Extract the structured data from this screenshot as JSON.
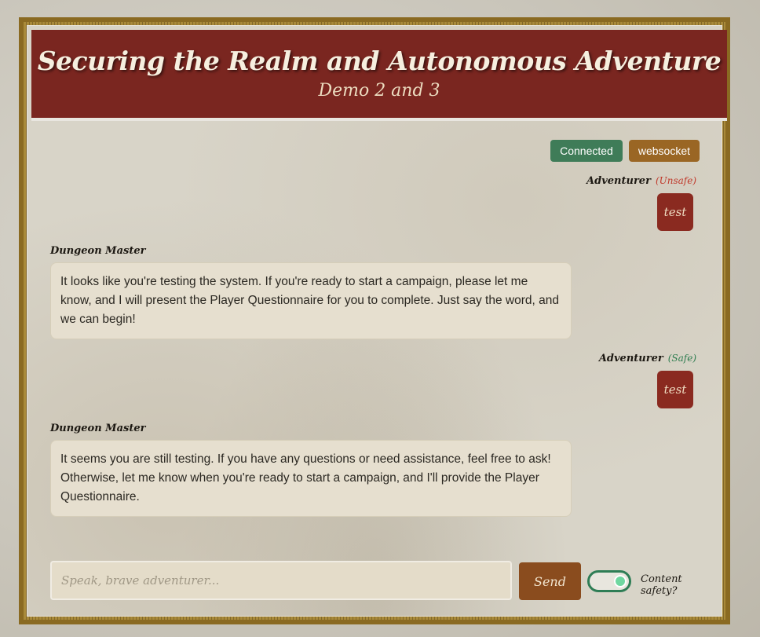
{
  "header": {
    "title": "Securing the Realm and Autonomous Adventure",
    "subtitle": "Demo 2 and 3"
  },
  "status": {
    "connection": "Connected",
    "transport": "websocket"
  },
  "messages": [
    {
      "role": "Adventurer",
      "safety": "(Unsafe)",
      "text": "test"
    },
    {
      "role": "Dungeon Master",
      "text": "It looks like you're testing the system. If you're ready to start a campaign, please let me know, and I will present the Player Questionnaire for you to complete. Just say the word, and we can begin!"
    },
    {
      "role": "Adventurer",
      "safety": "(Safe)",
      "text": "test"
    },
    {
      "role": "Dungeon Master",
      "text": "It seems you are still testing. If you have any questions or need assistance, feel free to ask! Otherwise, let me know when you're ready to start a campaign, and I'll provide the Player Questionnaire."
    }
  ],
  "composer": {
    "placeholder": "Speak, brave adventurer...",
    "send_label": "Send",
    "toggle_label": "Content safety?",
    "toggle_on": true
  },
  "colors": {
    "header_bg": "#7a2620",
    "connected": "#3f7c58",
    "websocket": "#9a6624",
    "send": "#8a4c1e",
    "toggle": "#2e7d55"
  }
}
